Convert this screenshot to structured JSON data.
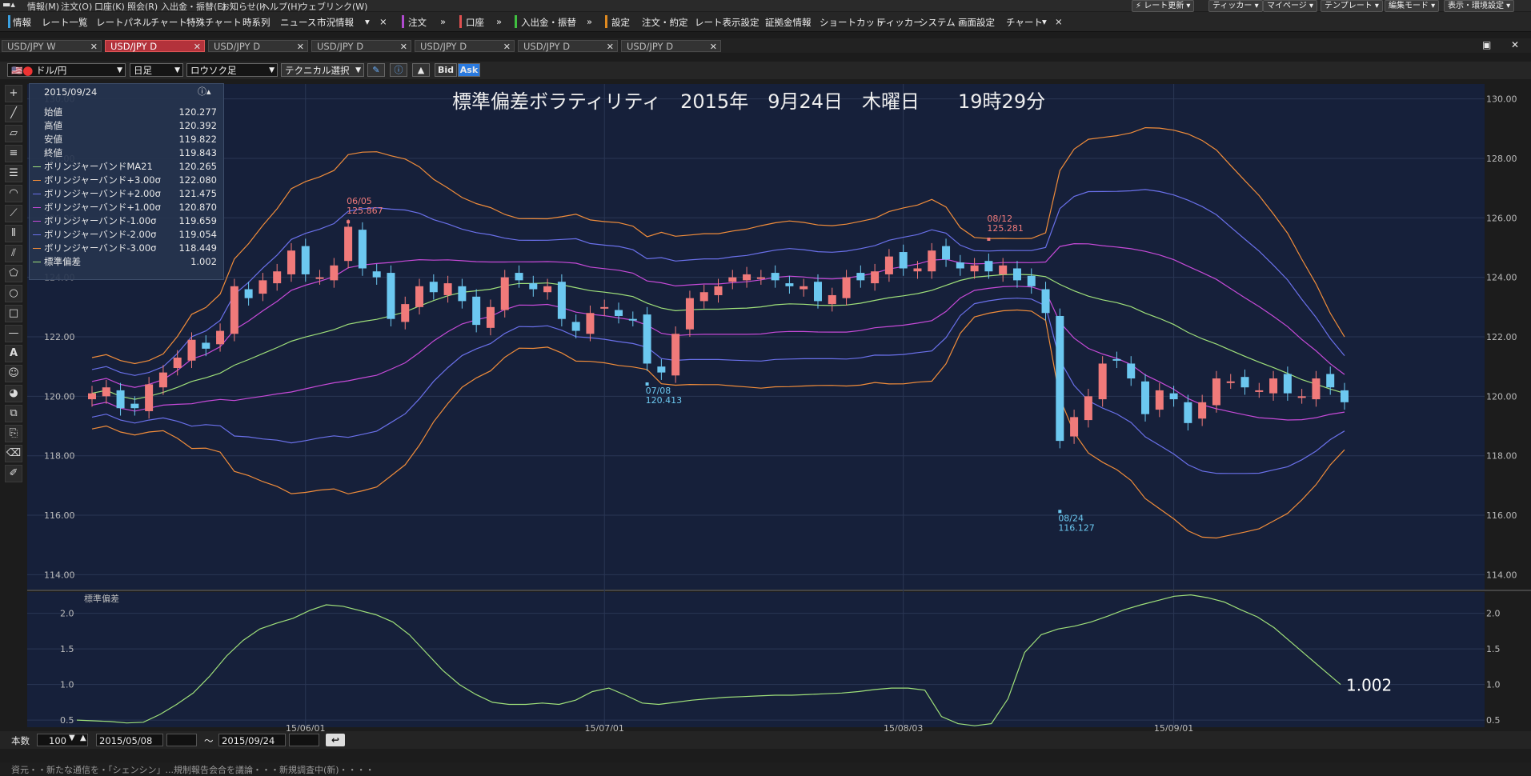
{
  "menubar": {
    "items": [
      "情報(M)",
      "注文(O)",
      "口座(K)",
      "照会(R)",
      "入出金・振替(E)",
      "お知らせ(I)",
      "ヘルプ(H)",
      "ウェブリンク(W)"
    ],
    "right_buttons": [
      "レート更新",
      "ティッカー",
      "マイページ",
      "テンプレート",
      "編集モード",
      "表示・環境設定"
    ]
  },
  "toolbar": {
    "group1_label": "情報",
    "group1": [
      "レート一覧",
      "レートパネル",
      "チャート",
      "特殊チャート",
      "時系列",
      "ニュース",
      "市況情報"
    ],
    "order_label": "注文",
    "account_label": "口座",
    "transfer_label": "入出金・振替",
    "settings_label": "設定",
    "settings_items": [
      "注文・約定",
      "レート表示設定",
      "証拠金情報",
      "ショートカット",
      "ティッカー",
      "システム",
      "画面設定",
      "チャート"
    ]
  },
  "tabs": [
    {
      "label": "USD/JPY W",
      "active": false
    },
    {
      "label": "USD/JPY D",
      "active": true
    },
    {
      "label": "USD/JPY D",
      "active": false
    },
    {
      "label": "USD/JPY D",
      "active": false
    },
    {
      "label": "USD/JPY D",
      "active": false
    },
    {
      "label": "USD/JPY D",
      "active": false
    },
    {
      "label": "USD/JPY D",
      "active": false
    }
  ],
  "chart_controls": {
    "currency": "ドル/円",
    "period": "日足",
    "chart_type": "ロウソク足",
    "technical": "テクニカル選択",
    "bid": "Bid",
    "ask": "Ask"
  },
  "info_panel": {
    "date": "2015/09/24",
    "rows": [
      {
        "label": "始値",
        "value": "120.277"
      },
      {
        "label": "高値",
        "value": "120.392"
      },
      {
        "label": "安値",
        "value": "119.822"
      },
      {
        "label": "終値",
        "value": "119.843"
      },
      {
        "label": "ボリンジャーバンドMA21",
        "value": "120.265",
        "color": "#9fe07a"
      },
      {
        "label": "ボリンジャーバンド+3.00σ",
        "value": "122.080",
        "color": "#f08c3a"
      },
      {
        "label": "ボリンジャーバンド+2.00σ",
        "value": "121.475",
        "color": "#6a70ea"
      },
      {
        "label": "ボリンジャーバンド+1.00σ",
        "value": "120.870",
        "color": "#c64ad8"
      },
      {
        "label": "ボリンジャーバンド-1.00σ",
        "value": "119.659",
        "color": "#c64ad8"
      },
      {
        "label": "ボリンジャーバンド-2.00σ",
        "value": "119.054",
        "color": "#6a70ea"
      },
      {
        "label": "ボリンジャーバンド-3.00σ",
        "value": "118.449",
        "color": "#f08c3a"
      },
      {
        "label": "標準偏差",
        "value": "1.002",
        "color": "#9fe07a"
      }
    ]
  },
  "overlay_title": "標準偏差ボラティリティ　2015年　9月24日　木曜日　　19時29分",
  "annotations": [
    {
      "date": "06/05",
      "value": "125.867",
      "color": "#f07a7a"
    },
    {
      "date": "08/12",
      "value": "125.281",
      "color": "#f07a7a"
    },
    {
      "date": "07/08",
      "value": "120.413",
      "color": "#6cc8f0"
    },
    {
      "date": "08/24",
      "value": "116.127",
      "color": "#6cc8f0"
    }
  ],
  "sub_panel_label": "標準偏差",
  "sub_last_value": "1.002",
  "colors": {
    "background": "#16203a",
    "up_candle": "#f07a7a",
    "down_candle": "#6cc8f0",
    "ma": "#9fe07a",
    "band3": "#f08c3a",
    "band2": "#6a70ea",
    "band1": "#c64ad8",
    "std": "#9fe07a"
  },
  "chart_data": [
    {
      "type": "candlestick",
      "xlabel": "",
      "ylabel": "",
      "ylim": [
        113.5,
        130.5
      ],
      "yticks": [
        "130.00",
        "128.00",
        "126.00",
        "124.00",
        "122.00",
        "120.00",
        "118.00",
        "116.00",
        "114.00"
      ],
      "xticks": [
        "15/06/01",
        "15/07/01",
        "15/08/03",
        "15/09/01"
      ],
      "series_close": [
        120.1,
        120.3,
        119.6,
        119.6,
        120.4,
        120.8,
        121.3,
        121.9,
        121.6,
        122.2,
        123.7,
        123.3,
        123.9,
        124.2,
        124.9,
        124.1,
        124.0,
        124.4,
        125.7,
        124.3,
        124.0,
        122.6,
        123.1,
        123.7,
        123.5,
        123.8,
        123.2,
        122.4,
        123.0,
        124.0,
        123.9,
        123.6,
        123.7,
        122.6,
        122.2,
        122.8,
        123.0,
        122.7,
        122.6,
        121.1,
        120.8,
        122.1,
        123.3,
        123.5,
        123.7,
        124.0,
        124.1,
        124.0,
        123.9,
        123.7,
        123.7,
        123.2,
        123.4,
        124.0,
        123.9,
        124.2,
        124.7,
        124.3,
        124.3,
        124.9,
        124.6,
        124.3,
        124.4,
        124.2,
        124.4,
        123.9,
        123.7,
        122.8,
        118.5,
        119.3,
        120.0,
        121.1,
        121.2,
        120.6,
        119.4,
        120.2,
        119.9,
        119.1,
        119.8,
        120.6,
        120.5,
        120.3,
        120.2,
        120.6,
        120.1,
        120.0,
        120.6,
        120.3,
        119.8
      ],
      "series": [
        {
          "name": "ボリンジャーバンドMA21",
          "last": 120.265
        },
        {
          "name": "ボリンジャーバンド+3.00σ",
          "last": 122.08
        },
        {
          "name": "ボリンジャーバンド+2.00σ",
          "last": 121.475
        },
        {
          "name": "ボリンジャーバンド+1.00σ",
          "last": 120.87
        },
        {
          "name": "ボリンジャーバンド-1.00σ",
          "last": 119.659
        },
        {
          "name": "ボリンジャーバンド-2.00σ",
          "last": 119.054
        },
        {
          "name": "ボリンジャーバンド-3.00σ",
          "last": 118.449
        }
      ]
    },
    {
      "type": "line",
      "title": "標準偏差",
      "xlabel": "",
      "ylabel": "",
      "ylim": [
        0.4,
        2.3
      ],
      "yticks": [
        "2.0",
        "1.5",
        "1.0",
        "0.5"
      ],
      "series": [
        {
          "name": "標準偏差",
          "values": [
            0.5,
            0.49,
            0.48,
            0.46,
            0.47,
            0.58,
            0.72,
            0.88,
            1.12,
            1.4,
            1.62,
            1.78,
            1.86,
            1.93,
            2.04,
            2.12,
            2.1,
            2.04,
            1.98,
            1.88,
            1.7,
            1.45,
            1.2,
            1.0,
            0.86,
            0.75,
            0.72,
            0.72,
            0.74,
            0.72,
            0.78,
            0.9,
            0.95,
            0.85,
            0.74,
            0.72,
            0.75,
            0.78,
            0.8,
            0.82,
            0.83,
            0.84,
            0.85,
            0.85,
            0.86,
            0.87,
            0.88,
            0.9,
            0.93,
            0.95,
            0.95,
            0.92,
            0.55,
            0.45,
            0.42,
            0.45,
            0.8,
            1.45,
            1.7,
            1.78,
            1.82,
            1.88,
            1.96,
            2.05,
            2.12,
            2.18,
            2.24,
            2.26,
            2.22,
            2.16,
            2.05,
            1.95,
            1.8,
            1.6,
            1.4,
            1.2,
            1.0
          ]
        }
      ]
    }
  ],
  "bottom": {
    "count_label": "本数",
    "count_value": "100",
    "from_date": "2015/05/08",
    "tilde": "～",
    "to_date": "2015/09/24"
  },
  "status_text": "資元・・新たな通信を・「シェンシン」...規制報告会合を議論・・・新規調査中(新)・・・・"
}
